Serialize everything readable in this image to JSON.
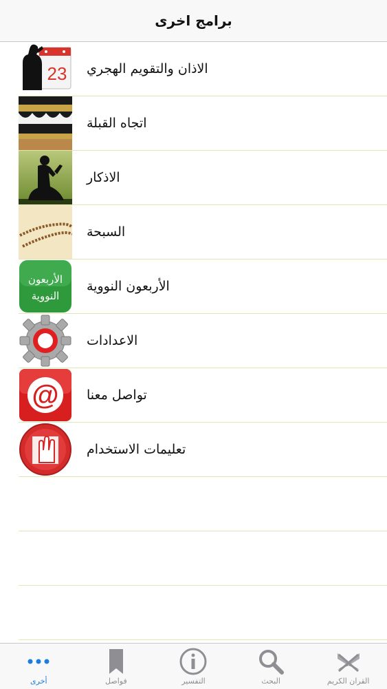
{
  "navbar": {
    "title": "برامج اخرى"
  },
  "items": [
    {
      "label": "الاذان والتقويم الهجري",
      "icon": "adhan-calendar-icon",
      "calendar_number": "23"
    },
    {
      "label": "اتجاه القبلة",
      "icon": "kaaba-icon"
    },
    {
      "label": "الاذكار",
      "icon": "praying-man-icon"
    },
    {
      "label": "السبحة",
      "icon": "prayer-beads-icon"
    },
    {
      "label": "الأربعون النووية",
      "icon": "forty-hadith-icon",
      "icon_text_line1": "الأربعون",
      "icon_text_line2": "النووية"
    },
    {
      "label": "الاعدادات",
      "icon": "settings-gear-icon"
    },
    {
      "label": "تواصل معنا",
      "icon": "at-sign-icon",
      "icon_text": "@"
    },
    {
      "label": "تعليمات الاستخدام",
      "icon": "hand-book-icon"
    }
  ],
  "tabs": [
    {
      "label": "أخرى",
      "icon": "more-dots-icon",
      "active": true
    },
    {
      "label": "فواصل",
      "icon": "bookmark-icon",
      "active": false
    },
    {
      "label": "التفسير",
      "icon": "info-icon",
      "active": false
    },
    {
      "label": "البحث",
      "icon": "search-icon",
      "active": false
    },
    {
      "label": "القران الكريم",
      "icon": "quran-book-icon",
      "active": false
    }
  ],
  "colors": {
    "accent": "#1a7de0",
    "separator": "#dfe8b0",
    "tab_inactive": "#8e8e93"
  }
}
